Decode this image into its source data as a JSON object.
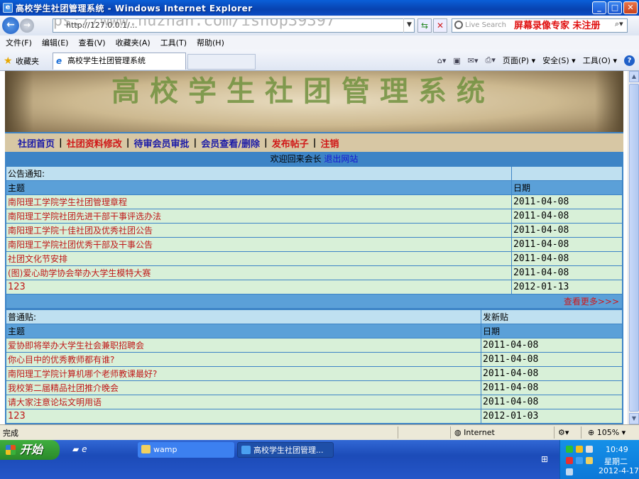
{
  "window": {
    "title": "高校学生社团管理系统 - Windows Internet Explorer"
  },
  "address": {
    "url": "http://127.0.0.1/...",
    "watermark": "https://www.huzhan.com/ishop39397"
  },
  "search": {
    "placeholder": "Live Search",
    "recorder_text": "屏幕录像专家 未注册"
  },
  "menu": [
    "文件(F)",
    "编辑(E)",
    "查看(V)",
    "收藏夹(A)",
    "工具(T)",
    "帮助(H)"
  ],
  "favbar": {
    "favorites_label": "收藏夹",
    "tab_title": "高校学生社团管理系统",
    "page_label": "页面(P)",
    "safety_label": "安全(S)",
    "tools_label": "工具(O)"
  },
  "banner": {
    "title": "高校学生社团管理系统"
  },
  "nav": {
    "items": [
      {
        "label": "社团首页",
        "red": false
      },
      {
        "label": "社团资料修改",
        "red": true
      },
      {
        "label": "待审会员审批",
        "red": false
      },
      {
        "label": "会员查看/删除",
        "red": false
      },
      {
        "label": "发布帖子",
        "red": true
      },
      {
        "label": "注销",
        "red": true
      }
    ]
  },
  "welcome": {
    "text": "欢迎回来会长",
    "exit_label": "退出网站"
  },
  "notices": {
    "section_label": "公告通知:",
    "col_subject": "主题",
    "col_date": "日期",
    "rows": [
      {
        "subject": "南阳理工学院学生社团管理章程",
        "date": "2011-04-08"
      },
      {
        "subject": "南阳理工学院社团先进干部干事评选办法",
        "date": "2011-04-08"
      },
      {
        "subject": "南阳理工学院十佳社团及优秀社团公告",
        "date": "2011-04-08"
      },
      {
        "subject": "南阳理工学院社团优秀干部及干事公告",
        "date": "2011-04-08"
      },
      {
        "subject": "社团文化节安排",
        "date": "2011-04-08"
      },
      {
        "subject": "(图)爱心助学协会举办大学生模特大赛",
        "date": "2011-04-08"
      },
      {
        "subject": "123",
        "date": "2012-01-13"
      }
    ],
    "more_label": "查看更多>>>"
  },
  "posts": {
    "section_label": "普通贴:",
    "new_post_label": "发新贴",
    "col_subject": "主题",
    "col_date": "日期",
    "rows": [
      {
        "subject": "爱协即将举办大学生社会兼职招聘会",
        "date": "2011-04-08"
      },
      {
        "subject": "你心目中的优秀教师都有谁?",
        "date": "2011-04-08"
      },
      {
        "subject": "南阳理工学院计算机哪个老师教课最好?",
        "date": "2011-04-08"
      },
      {
        "subject": "我校第二届精品社团推介晚会",
        "date": "2011-04-08"
      },
      {
        "subject": "请大家注意论坛文明用语",
        "date": "2011-04-08"
      },
      {
        "subject": "123",
        "date": "2012-01-03"
      }
    ]
  },
  "status": {
    "done": "完成",
    "zone": "Internet",
    "zoom": "105%"
  },
  "taskbar": {
    "start_label": "开始",
    "tasks": [
      {
        "label": "wamp"
      },
      {
        "label": "高校学生社团管理..."
      }
    ],
    "clock": "10:49",
    "weekday": "星期二",
    "date": "2012-4-17"
  },
  "colors": {
    "page_bg": "#3d84c6",
    "row_bg": "#d8f0d8",
    "link_red": "#c01818",
    "link_blue": "#1a1aa8"
  }
}
